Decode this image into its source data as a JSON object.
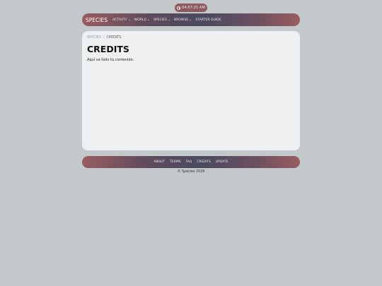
{
  "clock": {
    "time": "04:57:21 AM",
    "icon": "clock-icon"
  },
  "navbar": {
    "brand": "SPECIES",
    "items": [
      {
        "label": "ACTIVITY",
        "dropdown": true
      },
      {
        "label": "WORLD",
        "dropdown": true
      },
      {
        "label": "SPECIES",
        "dropdown": true
      },
      {
        "label": "BROWSE",
        "dropdown": true
      },
      {
        "label": "STARTER GUIDE",
        "dropdown": false
      }
    ]
  },
  "breadcrumb": {
    "root": "SPECIES",
    "separator": "/",
    "current": "CREDITS"
  },
  "page": {
    "title": "CREDITS",
    "content": "Aquí va todo tu contenido."
  },
  "footer": {
    "links": [
      "ABOUT",
      "TERMS",
      "FAQ",
      "CREDITS",
      "UPDATE"
    ],
    "copyright": "© Species 2026"
  },
  "colors": {
    "background": "#c3c8cb",
    "accent": "#9a5c61",
    "card": "#eef0f1"
  }
}
